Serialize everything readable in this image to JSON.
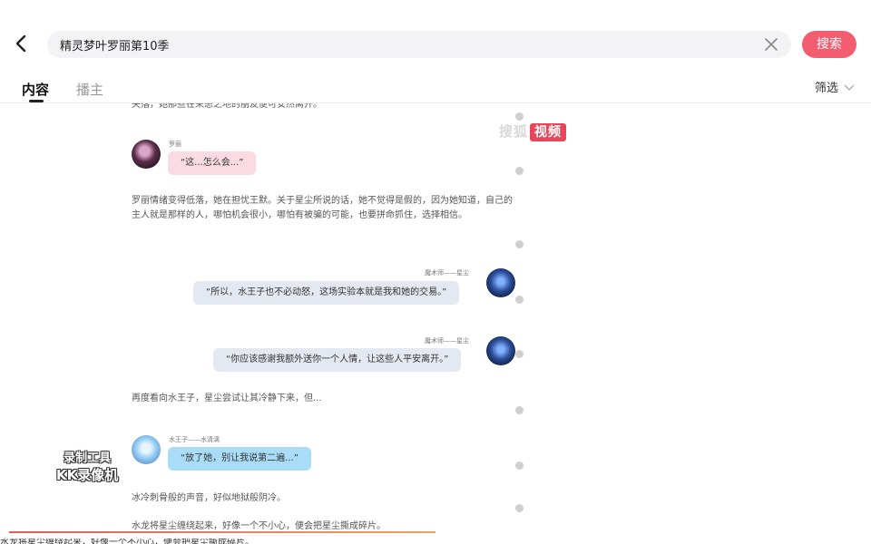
{
  "search": {
    "query": "精灵梦叶罗丽第10季",
    "button_label": "搜索"
  },
  "tabs": [
    {
      "label": "内容",
      "active": true
    },
    {
      "label": "播主",
      "active": false
    }
  ],
  "filter_label": "筛选",
  "video": {
    "top_partial_text": "失落，她那些在荣患之地的朋友便可安然离开。",
    "msg1": {
      "name": "罗丽",
      "text": "“这...怎么会...”"
    },
    "para1": "罗丽情绪变得低落，她在担忧王默。关于星尘所说的话，她不觉得是假的，因为她知道，自己的主人就是那样的人，哪怕机会很小，哪怕有被骗的可能，也要拼命抓住，选择相信。",
    "msg2": {
      "name": "魔术师——星尘",
      "text": "“所以，水王子也不必动怒，这场实验本就是我和她的交易。”"
    },
    "msg3": {
      "name": "魔术师——星尘",
      "text": "“你应该感谢我额外送你一个人情，让这些人平安离开。”"
    },
    "para2": "再度看向水王子，星尘尝试让其冷静下来，但...",
    "msg4": {
      "name": "水王子——水清漓",
      "text": "“放了她，别让我说第二遍...”"
    },
    "para3": "冰冷刺骨般的声音，好似地狱般阴冷。",
    "para4": "水龙将星尘缠绕起来，好像一个不小心，便会把星尘撕成碎片。",
    "watermark_sohu": "搜狐",
    "watermark_sohu_tag": "视频",
    "watermark_kk_line1": "录制工具",
    "watermark_kk_line2": "KK录像机",
    "progress": 0.5
  }
}
